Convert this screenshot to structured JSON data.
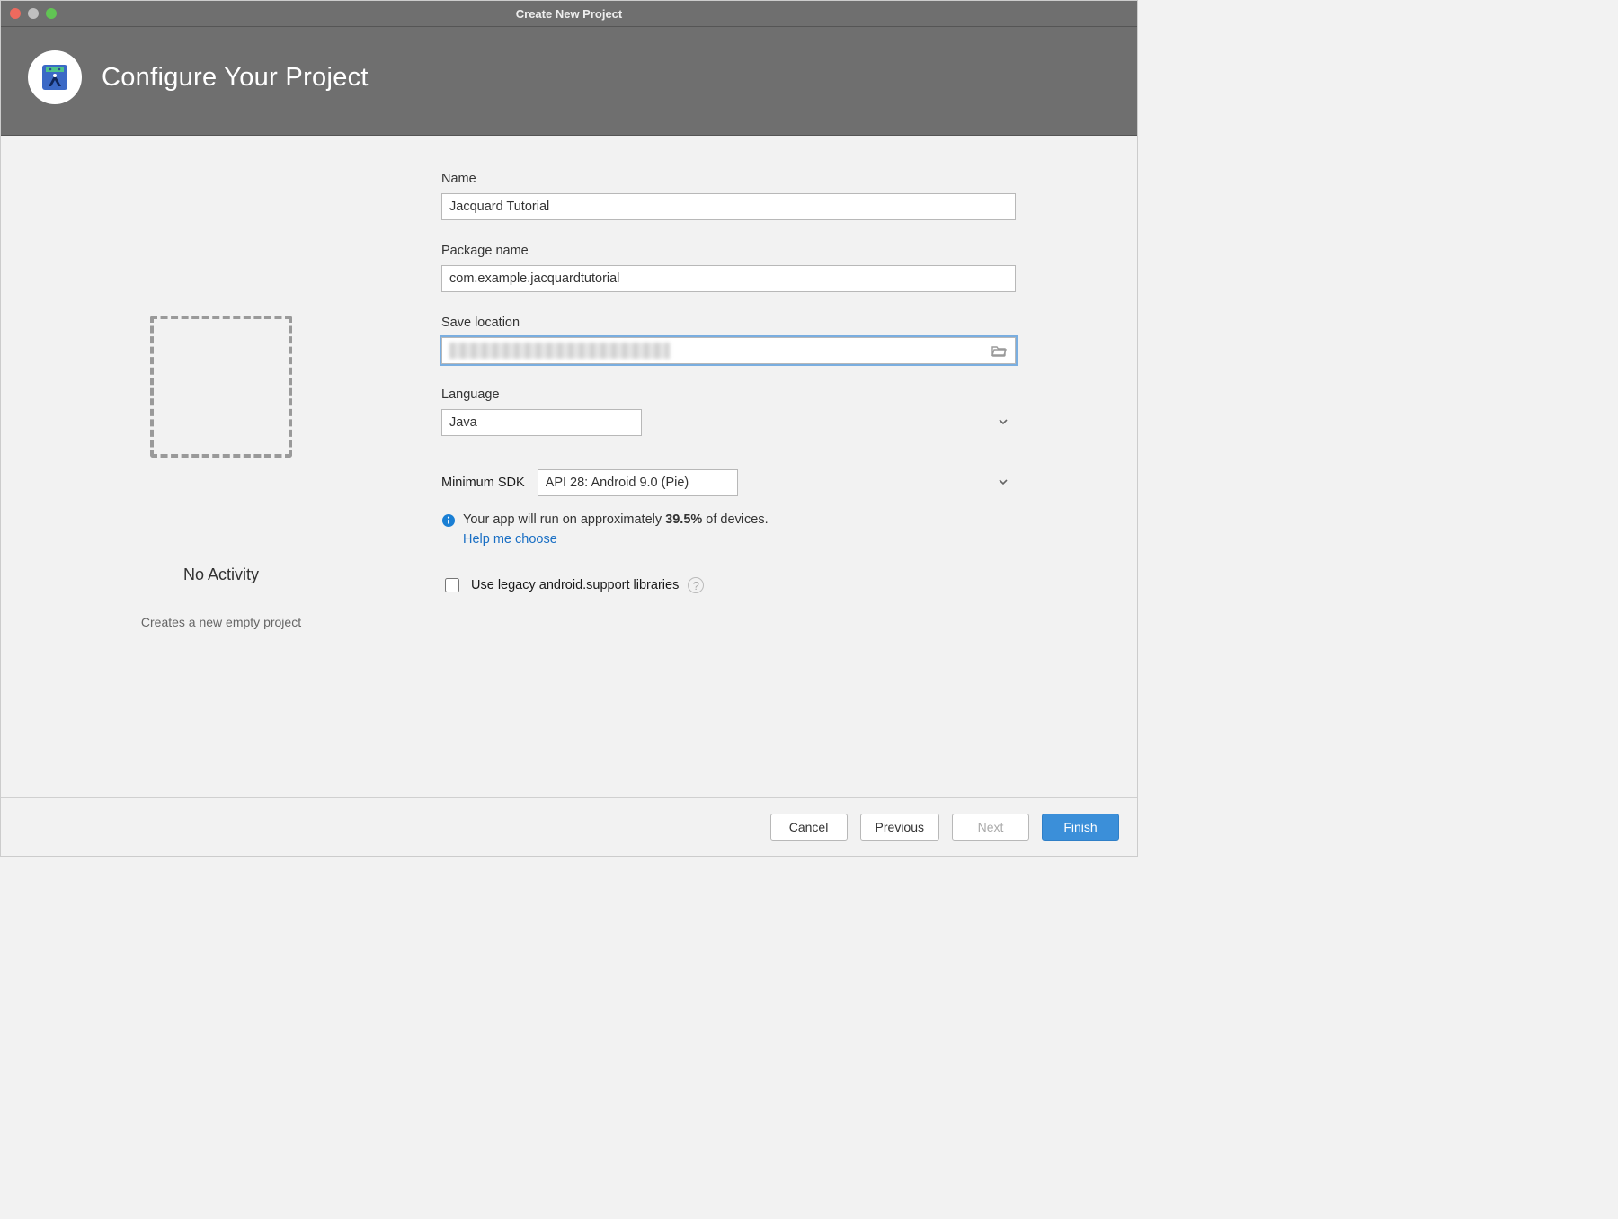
{
  "window": {
    "title": "Create New Project"
  },
  "header": {
    "heading": "Configure Your Project"
  },
  "preview": {
    "title": "No Activity",
    "subtitle": "Creates a new empty project"
  },
  "form": {
    "name_label": "Name",
    "name_value": "Jacquard Tutorial",
    "package_label": "Package name",
    "package_value": "com.example.jacquardtutorial",
    "location_label": "Save location",
    "location_value": "",
    "language_label": "Language",
    "language_value": "Java",
    "minsdk_label": "Minimum SDK",
    "minsdk_value": "API 28: Android 9.0 (Pie)",
    "info_prefix": "Your app will run on approximately ",
    "info_pct": "39.5%",
    "info_suffix": " of devices.",
    "help_link": "Help me choose",
    "legacy_label": "Use legacy android.support libraries",
    "legacy_checked": false
  },
  "footer": {
    "cancel": "Cancel",
    "previous": "Previous",
    "next": "Next",
    "finish": "Finish"
  }
}
